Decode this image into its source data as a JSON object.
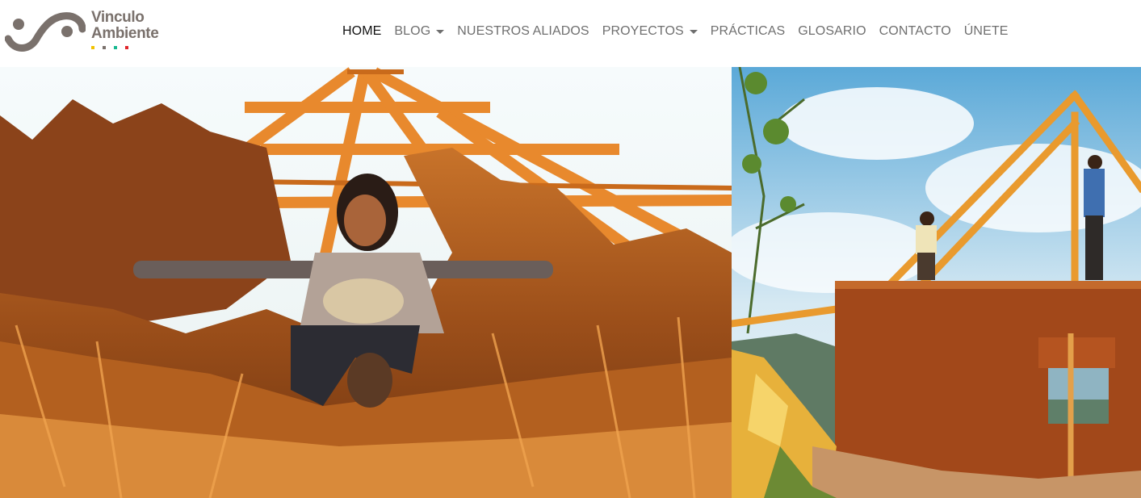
{
  "brand": {
    "line1": "Vinculo",
    "line2": "Ambiente",
    "mark_color": "#7a716c",
    "dot_colors": [
      "#f2c200",
      "#7a716c",
      "#17b890",
      "#e0262b"
    ]
  },
  "nav": {
    "items": [
      {
        "label": "HOME",
        "active": true,
        "dropdown": false
      },
      {
        "label": "BLOG",
        "active": false,
        "dropdown": true
      },
      {
        "label": "NUESTROS ALIADOS",
        "active": false,
        "dropdown": false
      },
      {
        "label": "PROYECTOS",
        "active": false,
        "dropdown": true
      },
      {
        "label": "PRÁCTICAS",
        "active": false,
        "dropdown": false
      },
      {
        "label": "GLOSARIO",
        "active": false,
        "dropdown": false
      },
      {
        "label": "CONTACTO",
        "active": false,
        "dropdown": false
      },
      {
        "label": "ÚNETE",
        "active": false,
        "dropdown": false
      }
    ],
    "text_color": "#6f6f6f",
    "active_color": "#111111"
  },
  "hero": {
    "photos": [
      {
        "subject": "person-on-thatched-roof-frame"
      },
      {
        "subject": "builders-on-adobe-house-roof-frame"
      }
    ]
  }
}
